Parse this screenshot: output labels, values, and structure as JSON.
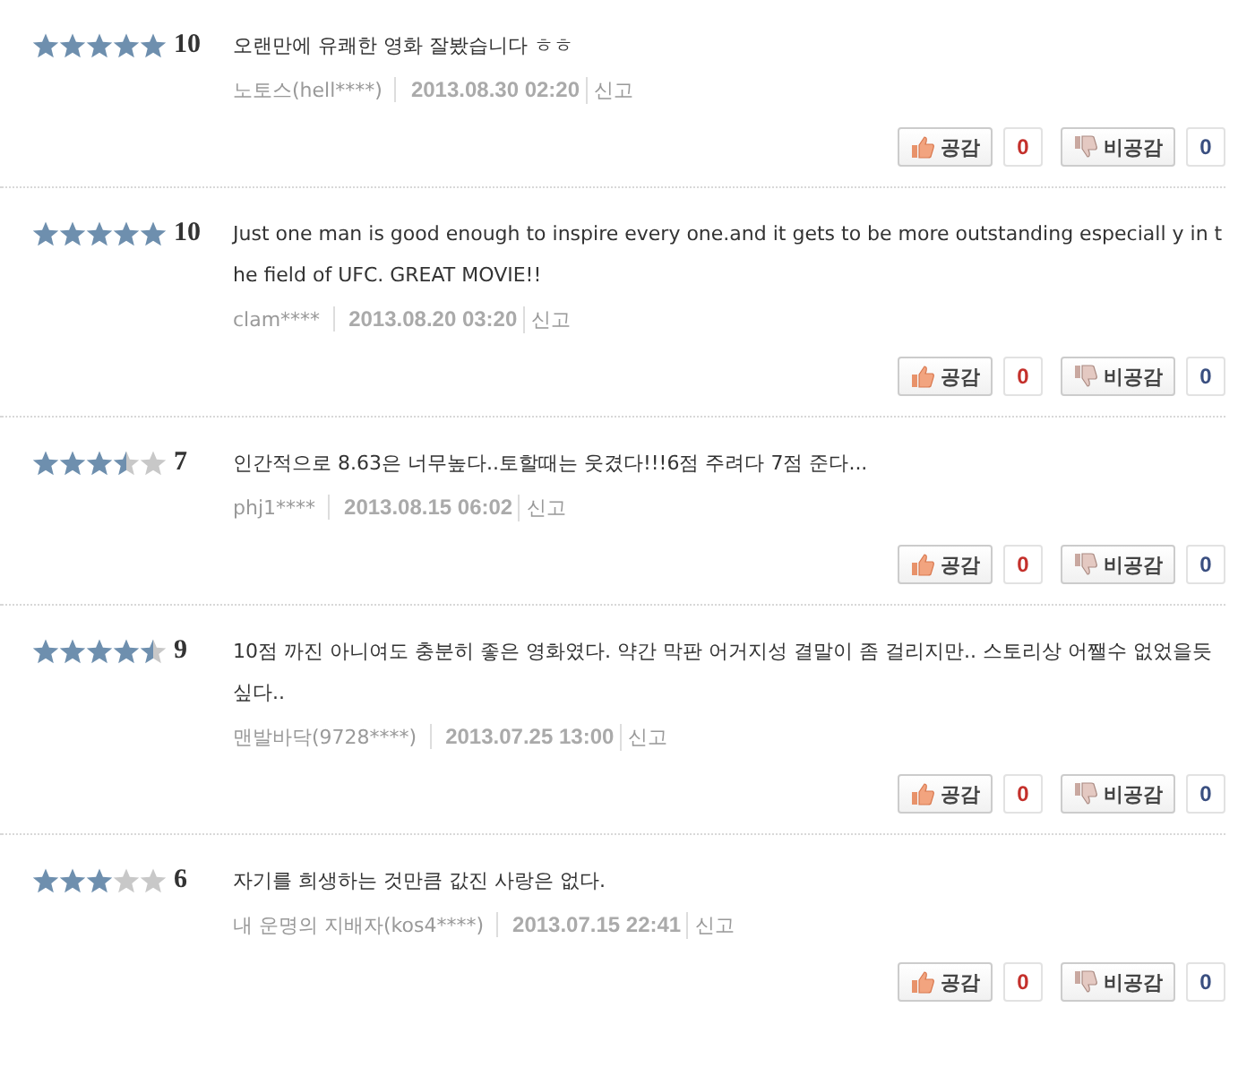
{
  "reviews": [
    {
      "stars": 5,
      "score": "10",
      "text": "오랜만에 유쾌한 영화 잘봤습니다 ㅎㅎ",
      "author": "노토스(hell****)",
      "date": "2013.08.30 02:20",
      "report": "신고",
      "like_label": "공감",
      "like_count": "0",
      "dislike_label": "비공감",
      "dislike_count": "0"
    },
    {
      "stars": 5,
      "score": "10",
      "text": "Just one man is good enough to inspire every one.and it gets to be more outstanding especiall y in the field of UFC. GREAT MOVIE!!",
      "author": "clam****",
      "date": "2013.08.20 03:20",
      "report": "신고",
      "like_label": "공감",
      "like_count": "0",
      "dislike_label": "비공감",
      "dislike_count": "0"
    },
    {
      "stars": 3.5,
      "score": "7",
      "text": "인간적으로 8.63은 너무높다..토할때는 웃겼다!!!6점 주려다 7점 준다...",
      "author": "phj1****",
      "date": "2013.08.15 06:02",
      "report": "신고",
      "like_label": "공감",
      "like_count": "0",
      "dislike_label": "비공감",
      "dislike_count": "0"
    },
    {
      "stars": 4.5,
      "score": "9",
      "text": "10점 까진 아니여도 충분히 좋은 영화였다. 약간 막판 어거지성 결말이 좀 걸리지만.. 스토리상 어쨀수 없었을듯 싶다..",
      "author": "맨발바닥(9728****)",
      "date": "2013.07.25 13:00",
      "report": "신고",
      "like_label": "공감",
      "like_count": "0",
      "dislike_label": "비공감",
      "dislike_count": "0"
    },
    {
      "stars": 3,
      "score": "6",
      "text": "자기를 희생하는 것만큼 값진 사랑은 없다.",
      "author": "내 운명의 지배자(kos4****)",
      "date": "2013.07.15 22:41",
      "report": "신고",
      "like_label": "공감",
      "like_count": "0",
      "dislike_label": "비공감",
      "dislike_count": "0"
    }
  ]
}
